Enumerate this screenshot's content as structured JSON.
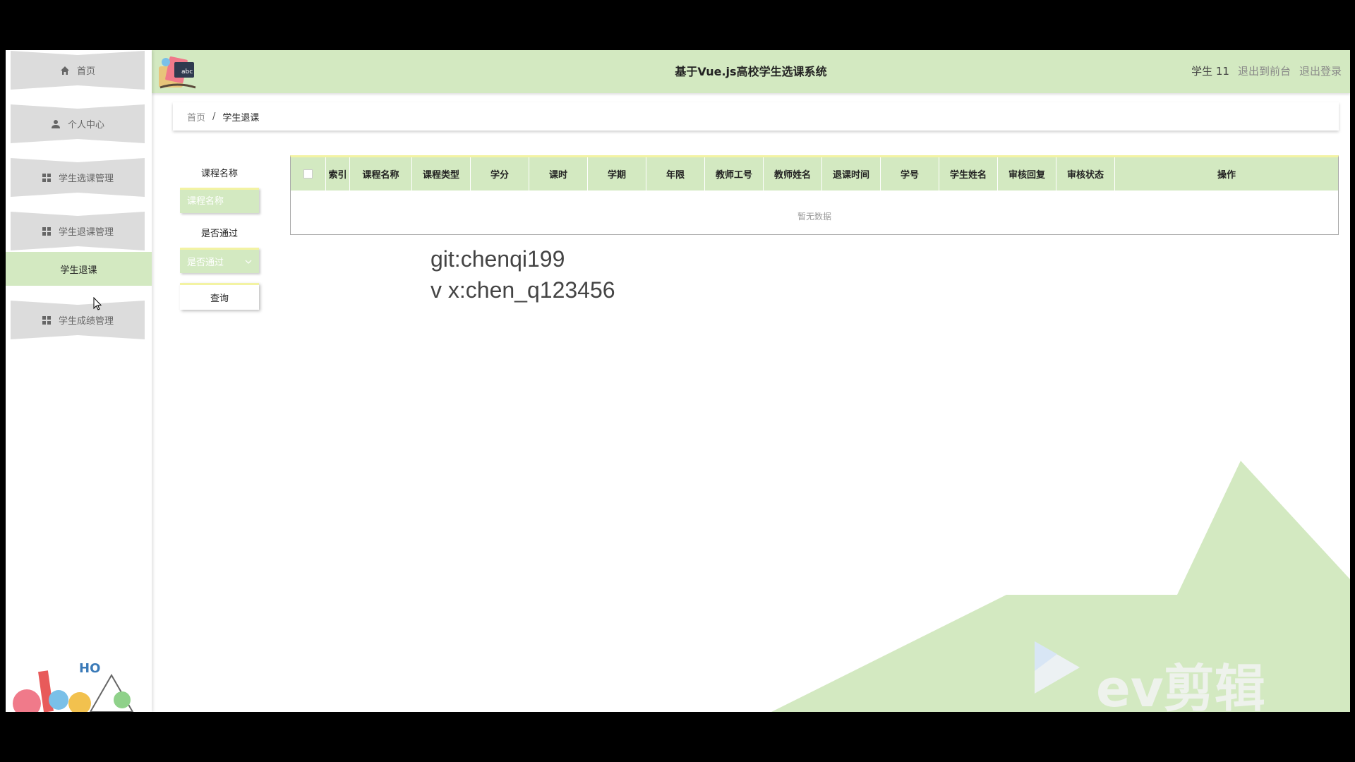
{
  "sidebar": {
    "items": [
      {
        "label": "首页",
        "icon": "home-icon"
      },
      {
        "label": "个人中心",
        "icon": "user-icon"
      },
      {
        "label": "学生选课管理",
        "icon": "grid-icon"
      },
      {
        "label": "学生退课管理",
        "icon": "grid-icon"
      },
      {
        "label": "学生成绩管理",
        "icon": "grid-icon"
      }
    ],
    "active_subitem": "学生退课"
  },
  "header": {
    "title": "基于Vue.js高校学生选课系统",
    "user": "学生 11",
    "back_front": "退出到前台",
    "logout": "退出登录"
  },
  "breadcrumb": {
    "home": "首页",
    "separator": "/",
    "current": "学生退课"
  },
  "filters": {
    "course_name_label": "课程名称",
    "course_name_placeholder": "课程名称",
    "course_name_value": "",
    "passed_label": "是否通过",
    "passed_placeholder": "是否通过",
    "query_label": "查询"
  },
  "table": {
    "columns": [
      "索引",
      "课程名称",
      "课程类型",
      "学分",
      "课时",
      "学期",
      "年限",
      "教师工号",
      "教师姓名",
      "退课时间",
      "学号",
      "学生姓名",
      "审核回复",
      "审核状态",
      "操作"
    ],
    "empty_text": "暂无数据"
  },
  "watermark": {
    "line1": "git:chenqi199",
    "line2": "v x:chen_q123456",
    "brand": "ev剪辑"
  },
  "colors": {
    "accent": "#d3e9c1",
    "accent_border": "#f3f3a3",
    "sidebar_item": "#dcdcdc"
  }
}
